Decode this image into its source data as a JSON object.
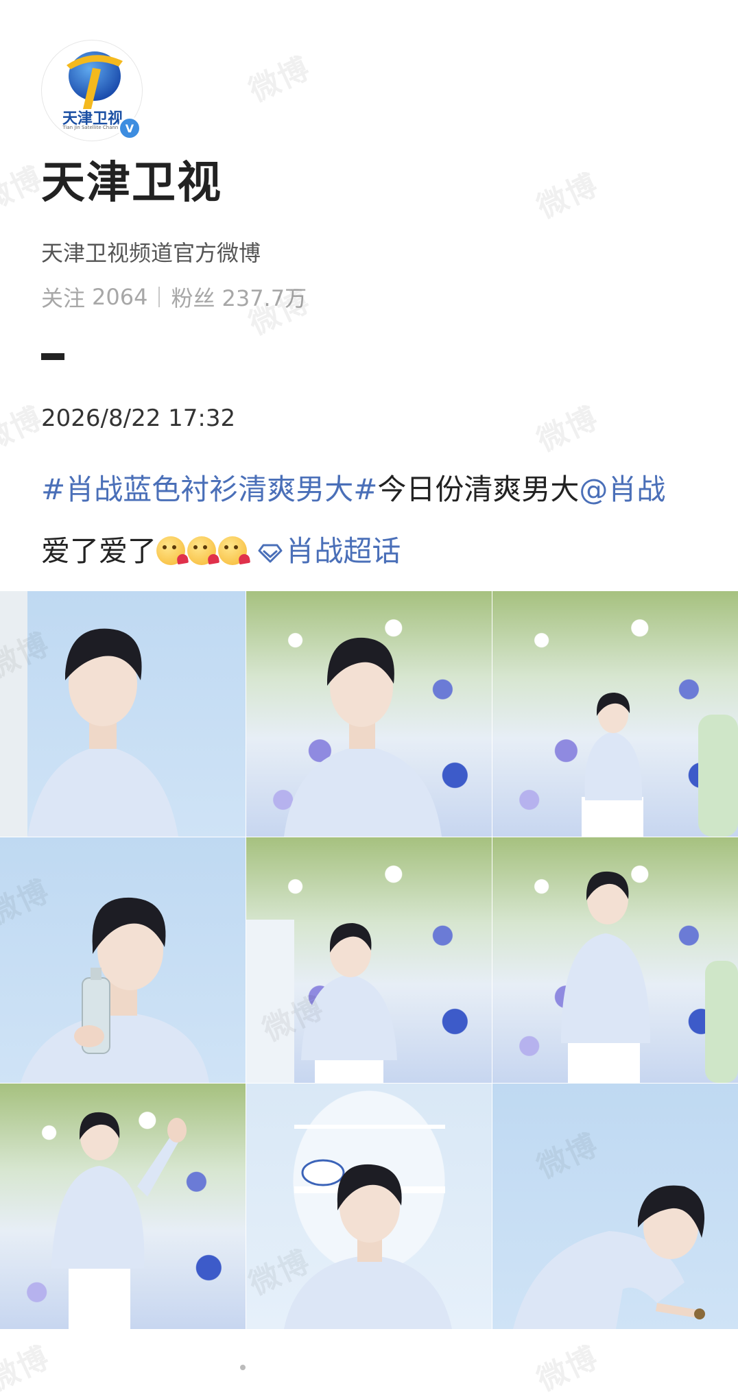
{
  "account": {
    "logo_text": "天津卫视",
    "logo_subtext": "Tian Jin Satellite Channel",
    "verified_mark": "V",
    "name": "天津卫视",
    "description": "天津卫视频道官方微博",
    "following_label": "关注",
    "following_count": "2064",
    "followers_label": "粉丝",
    "followers_count": "237.7万"
  },
  "post": {
    "time": "2026/8/22 17:32",
    "hashtag": "#肖战蓝色衬衫清爽男大#",
    "text_1": "今日份清爽男大",
    "mention": "@肖战",
    "text_2": "爱了爱了",
    "emoji_name": "heart-kiss-emoji",
    "supertopic": "肖战超话"
  },
  "watermark": "微博",
  "photos": [
    {
      "alt": "portrait-sky-background"
    },
    {
      "alt": "portrait-floral-background"
    },
    {
      "alt": "full-body-floral-wall"
    },
    {
      "alt": "holding-bottle-sky-background"
    },
    {
      "alt": "looking-down-floral-wall"
    },
    {
      "alt": "standing-floral-wall"
    },
    {
      "alt": "waving-floral-wall"
    },
    {
      "alt": "smiling-arch-background"
    },
    {
      "alt": "leaning-sky-background"
    }
  ],
  "colors": {
    "link": "#4a6fb8",
    "verified": "#3d8de0",
    "muted": "#a7a7a7",
    "shirt": "#dce6f6"
  }
}
